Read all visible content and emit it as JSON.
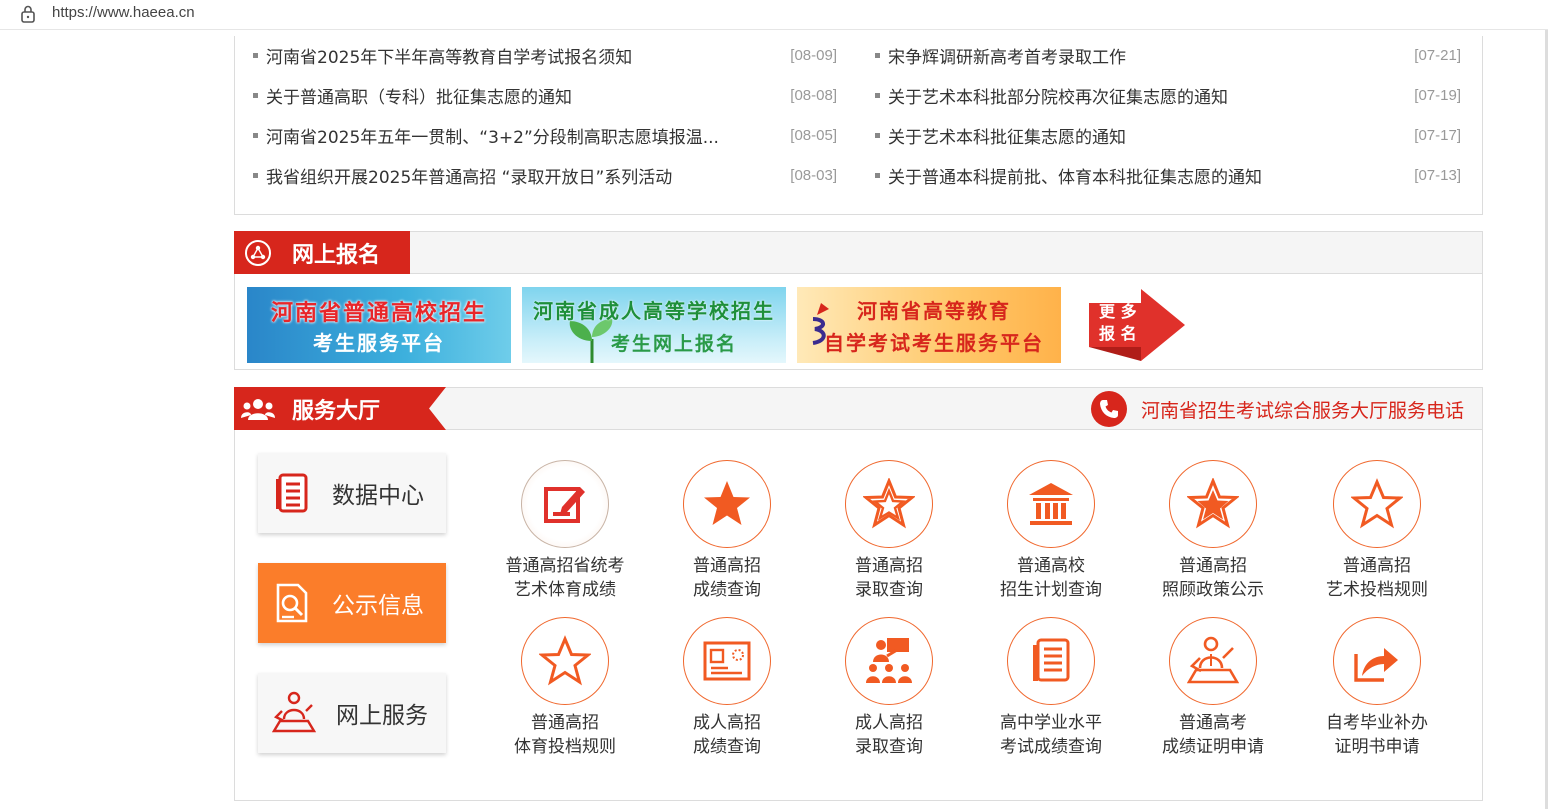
{
  "browser": {
    "url": "https://www.haeea.cn"
  },
  "news": {
    "left": [
      {
        "title": "河南省2025年下半年高等教育自学考试报名须知",
        "date": "[08-09]"
      },
      {
        "title": "关于普通高职（专科）批征集志愿的通知",
        "date": "[08-08]"
      },
      {
        "title": "河南省2025年五年一贯制、“3+2”分段制高职志愿填报温...",
        "date": "[08-05]"
      },
      {
        "title": "我省组织开展2025年普通高招 “录取开放日”系列活动",
        "date": "[08-03]"
      }
    ],
    "right": [
      {
        "title": "宋争辉调研新高考首考录取工作",
        "date": "[07-21]"
      },
      {
        "title": "关于艺术本科批部分院校再次征集志愿的通知",
        "date": "[07-19]"
      },
      {
        "title": "关于艺术本科批征集志愿的通知",
        "date": "[07-17]"
      },
      {
        "title": "关于普通本科提前批、体育本科批征集志愿的通知",
        "date": "[07-13]"
      }
    ]
  },
  "online_reg": {
    "title": "网上报名",
    "banners": [
      {
        "line1": "河南省普通高校招生",
        "line2": "考生服务平台"
      },
      {
        "line1": "河南省成人高等学校招生",
        "line2": "考生网上报名"
      },
      {
        "line1": "河南省高等教育",
        "line2": "自学考试考生服务平台"
      }
    ],
    "more": {
      "line1": "更 多",
      "line2": "报 名"
    }
  },
  "service_hall": {
    "title": "服务大厅",
    "hotline": "河南省招生考试综合服务大厅服务电话",
    "side": [
      {
        "label": "数据中心"
      },
      {
        "label": "公示信息"
      },
      {
        "label": "网上服务"
      }
    ],
    "items": [
      {
        "line1": "普通高招省统考",
        "line2": "艺术体育成绩",
        "icon": "edit-icon"
      },
      {
        "line1": "普通高招",
        "line2": "成绩查询",
        "icon": "star-solid-icon"
      },
      {
        "line1": "普通高招",
        "line2": "录取查询",
        "icon": "star-double-icon"
      },
      {
        "line1": "普通高校",
        "line2": "招生计划查询",
        "icon": "building-icon"
      },
      {
        "line1": "普通高招",
        "line2": "照顾政策公示",
        "icon": "star-badge-icon"
      },
      {
        "line1": "普通高招",
        "line2": "艺术投档规则",
        "icon": "star-outline-icon"
      },
      {
        "line1": "普通高招",
        "line2": "体育投档规则",
        "icon": "star-outline-icon"
      },
      {
        "line1": "成人高招",
        "line2": "成绩查询",
        "icon": "certificate-icon"
      },
      {
        "line1": "成人高招",
        "line2": "录取查询",
        "icon": "classroom-icon"
      },
      {
        "line1": "高中学业水平",
        "line2": "考试成绩查询",
        "icon": "document-icon"
      },
      {
        "line1": "普通高考",
        "line2": "成绩证明申请",
        "icon": "person-desk-icon"
      },
      {
        "line1": "自考毕业补办",
        "line2": "证明书申请",
        "icon": "export-icon"
      }
    ]
  },
  "colors": {
    "brand_red": "#d7261c",
    "accent_orange": "#fb7d2a",
    "icon_orange": "#f0682e"
  }
}
